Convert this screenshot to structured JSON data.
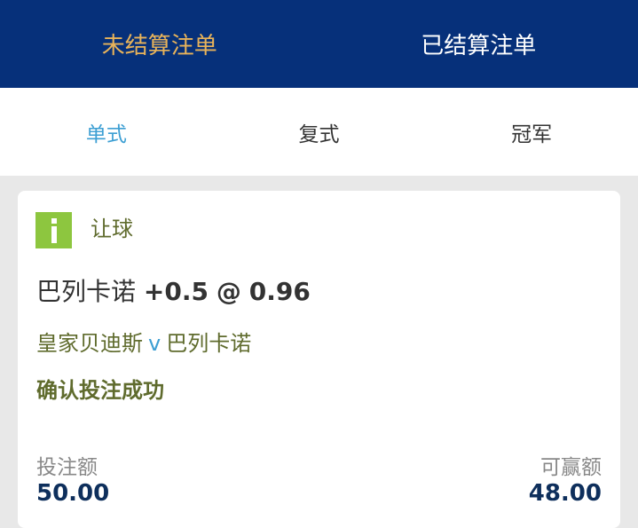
{
  "top_tabs": {
    "unsettled": "未结算注单",
    "settled": "已结算注单"
  },
  "sub_tabs": {
    "single": "单式",
    "parlay": "复式",
    "outright": "冠军"
  },
  "bet": {
    "type": "让球",
    "selection_team": "巴列卡诺",
    "selection_handicap": "+0.5",
    "selection_at": "@",
    "selection_odds": "0.96",
    "home_team": "皇家贝迪斯",
    "vs": "v",
    "away_team": "巴列卡诺",
    "status": "确认投注成功",
    "stake_label": "投注额",
    "stake_value": "50.00",
    "win_label": "可赢额",
    "win_value": "48.00"
  },
  "colors": {
    "header_bg": "#06307a",
    "active_top_tab": "#e8b35a",
    "active_sub_tab": "#3d9fd3",
    "info_icon_bg": "#8dc63f",
    "olive_text": "#5f6b2d",
    "amount_text": "#0e2f5c"
  },
  "icons": {
    "bet_info": "info-icon"
  }
}
